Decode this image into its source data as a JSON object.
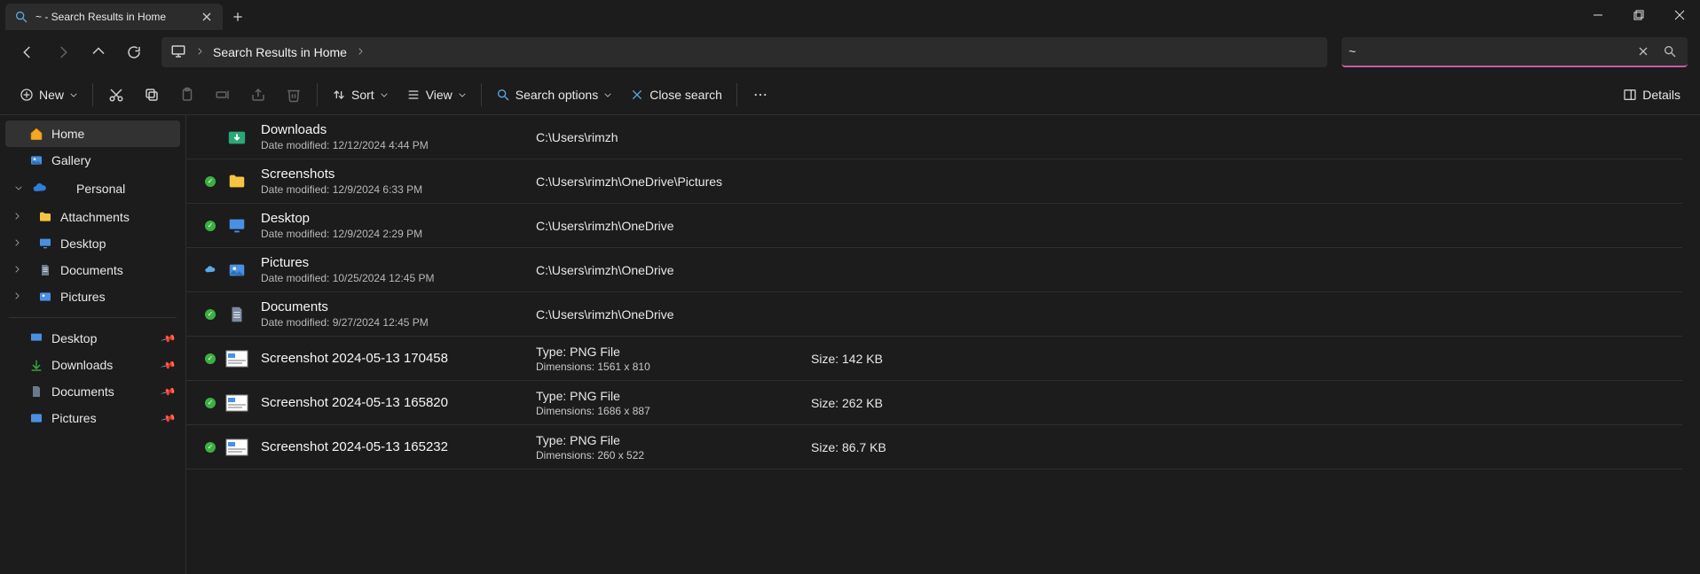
{
  "tab": {
    "title": "~ - Search Results in Home"
  },
  "address": {
    "text": "Search Results in Home"
  },
  "search": {
    "value": "~"
  },
  "toolbar": {
    "new": "New",
    "sort": "Sort",
    "view": "View",
    "search_options": "Search options",
    "close_search": "Close search",
    "details": "Details"
  },
  "sidebar": {
    "home": "Home",
    "gallery": "Gallery",
    "personal": "Personal",
    "attachments": "Attachments",
    "desktop": "Desktop",
    "documents": "Documents",
    "pictures": "Pictures",
    "quick_desktop": "Desktop",
    "quick_downloads": "Downloads",
    "quick_documents": "Documents",
    "quick_pictures": "Pictures"
  },
  "results": [
    {
      "status": "none",
      "icon": "downloads",
      "name": "Downloads",
      "sub_prefix": "Date modified: ",
      "sub_value": "12/12/2024 4:44 PM",
      "col2_top": "C:\\Users\\rimzh",
      "col2_bot": "",
      "col3_top": ""
    },
    {
      "status": "sync",
      "icon": "folder",
      "name": "Screenshots",
      "sub_prefix": "Date modified: ",
      "sub_value": "12/9/2024 6:33 PM",
      "col2_top": "C:\\Users\\rimzh\\OneDrive\\Pictures",
      "col2_bot": "",
      "col3_top": ""
    },
    {
      "status": "sync",
      "icon": "desktop",
      "name": "Desktop",
      "sub_prefix": "Date modified: ",
      "sub_value": "12/9/2024 2:29 PM",
      "col2_top": "C:\\Users\\rimzh\\OneDrive",
      "col2_bot": "",
      "col3_top": ""
    },
    {
      "status": "cloud",
      "icon": "pictures",
      "name": "Pictures",
      "sub_prefix": "Date modified: ",
      "sub_value": "10/25/2024 12:45 PM",
      "col2_top": "C:\\Users\\rimzh\\OneDrive",
      "col2_bot": "",
      "col3_top": ""
    },
    {
      "status": "sync",
      "icon": "documents",
      "name": "Documents",
      "sub_prefix": "Date modified: ",
      "sub_value": "9/27/2024 12:45 PM",
      "col2_top": "C:\\Users\\rimzh\\OneDrive",
      "col2_bot": "",
      "col3_top": ""
    },
    {
      "status": "sync",
      "icon": "png",
      "name": "Screenshot 2024-05-13 170458",
      "sub_prefix": "",
      "sub_value": "",
      "col2_top": "Type: PNG File",
      "col2_bot": "Dimensions: 1561 x 810",
      "col3_top": "Size: 142 KB"
    },
    {
      "status": "sync",
      "icon": "png",
      "name": "Screenshot 2024-05-13 165820",
      "sub_prefix": "",
      "sub_value": "",
      "col2_top": "Type: PNG File",
      "col2_bot": "Dimensions: 1686 x 887",
      "col3_top": "Size: 262 KB"
    },
    {
      "status": "sync",
      "icon": "png",
      "name": "Screenshot 2024-05-13 165232",
      "sub_prefix": "",
      "sub_value": "",
      "col2_top": "Type: PNG File",
      "col2_bot": "Dimensions: 260 x 522",
      "col3_top": "Size: 86.7 KB"
    }
  ]
}
